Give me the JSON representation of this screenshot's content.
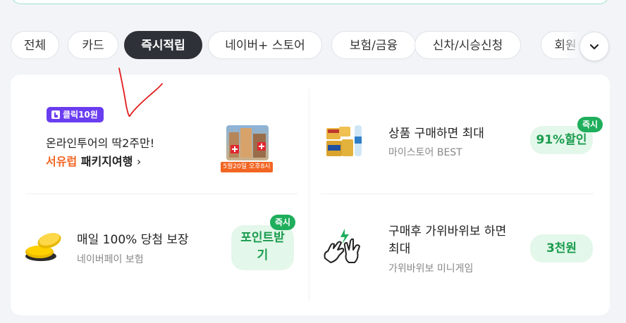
{
  "tabs": [
    {
      "label": "전체",
      "active": false
    },
    {
      "label": "카드",
      "active": false
    },
    {
      "label": "즉시적립",
      "active": true
    },
    {
      "label": "네이버+ 스토어",
      "active": false
    },
    {
      "label": "보험/금융",
      "active": false
    },
    {
      "label": "신차/시승신청",
      "active": false
    },
    {
      "label": "회원",
      "active": false
    }
  ],
  "promos": {
    "travel": {
      "badge": "클릭10원",
      "line1": "온라인투어의 딱2주만!",
      "highlight": "서유럽",
      "line2_rest": " 패키지여행",
      "arrow": "›",
      "date_tag": "5월20일 오후8시"
    },
    "store": {
      "title": "상품 구매하면 최대",
      "subtitle": "마이스토어 BEST",
      "reward": "91%할인",
      "instant": "즉시"
    },
    "insurance": {
      "title": "매일 100% 당첨 보장",
      "subtitle": "네이버페이 보험",
      "reward": "포인트받기",
      "instant": "즉시"
    },
    "game": {
      "title_line1": "구매후 가위바위보 하면",
      "title_line2": "최대",
      "subtitle": "가위바위보 미니게임",
      "reward": "3천원"
    }
  },
  "colors": {
    "accent_green": "#1fae5c",
    "badge_purple": "#6a3df0",
    "highlight_orange": "#f26522",
    "active_tab": "#2e3138",
    "annotation_red": "#e01b1b"
  },
  "icons": {
    "more": "chevron-down-icon",
    "badge": "tap-hand-icon",
    "coins": "gold-coins-icon",
    "game": "rock-paper-scissors-icon",
    "store": "product-bundle-icon"
  }
}
